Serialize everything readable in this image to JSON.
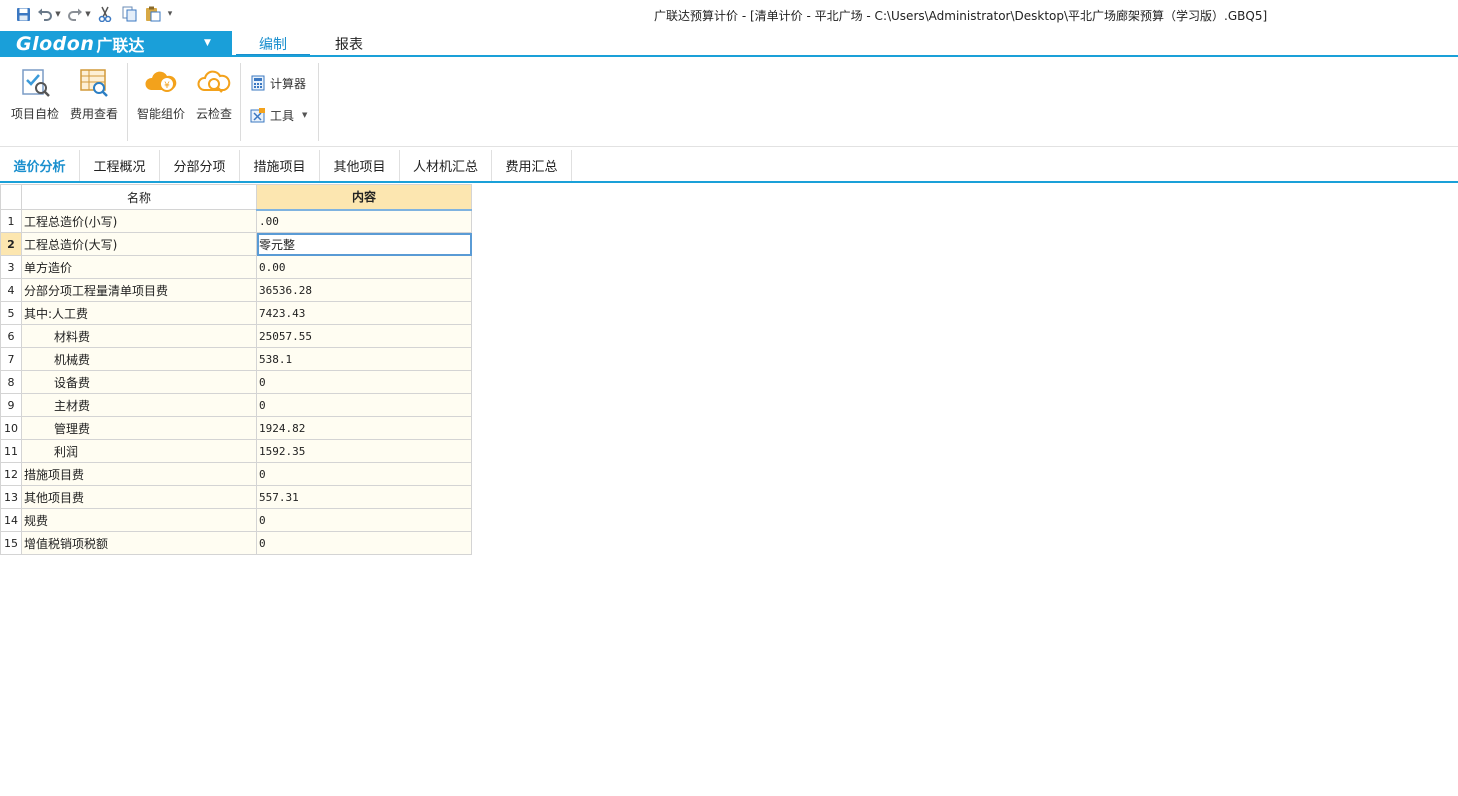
{
  "title": "广联达预算计价 - [清单计价 - 平北广场 - C:\\Users\\Administrator\\Desktop\\平北广场廊架预算（学习版）.GBQ5]",
  "logo": {
    "brand": "Glodon",
    "brand_cn": "广联达"
  },
  "menu": {
    "tabs": [
      {
        "label": "编制"
      },
      {
        "label": "报表"
      }
    ]
  },
  "ribbon": {
    "buttons": [
      {
        "label": "项目自检"
      },
      {
        "label": "费用查看"
      },
      {
        "label": "智能组价"
      },
      {
        "label": "云检查"
      }
    ],
    "small": [
      {
        "label": "计算器"
      },
      {
        "label": "工具"
      }
    ]
  },
  "doc_tabs": [
    {
      "label": "造价分析"
    },
    {
      "label": "工程概况"
    },
    {
      "label": "分部分项"
    },
    {
      "label": "措施项目"
    },
    {
      "label": "其他项目"
    },
    {
      "label": "人材机汇总"
    },
    {
      "label": "费用汇总"
    }
  ],
  "grid": {
    "headers": {
      "name": "名称",
      "content": "内容"
    },
    "rows": [
      {
        "no": "1",
        "name": "工程总造价(小写)",
        "value": ".00"
      },
      {
        "no": "2",
        "name": "工程总造价(大写)",
        "value": "零元整"
      },
      {
        "no": "3",
        "name": "单方造价",
        "value": "0.00"
      },
      {
        "no": "4",
        "name": "分部分项工程量清单项目费",
        "value": "36536.28"
      },
      {
        "no": "5",
        "name": "其中:人工费",
        "value": "7423.43"
      },
      {
        "no": "6",
        "name": "材料费",
        "value": "25057.55"
      },
      {
        "no": "7",
        "name": "机械费",
        "value": "538.1"
      },
      {
        "no": "8",
        "name": "设备费",
        "value": "0"
      },
      {
        "no": "9",
        "name": "主材费",
        "value": "0"
      },
      {
        "no": "10",
        "name": "管理费",
        "value": "1924.82"
      },
      {
        "no": "11",
        "name": "利润",
        "value": "1592.35"
      },
      {
        "no": "12",
        "name": "措施项目费",
        "value": "0"
      },
      {
        "no": "13",
        "name": "其他项目费",
        "value": "557.31"
      },
      {
        "no": "14",
        "name": "规费",
        "value": "0"
      },
      {
        "no": "15",
        "name": "增值税销项税额",
        "value": "0"
      }
    ]
  },
  "colors": {
    "accent": "#1a9fd9",
    "header_highlight": "#fce6b0",
    "cell_bg": "#fffdf2"
  },
  "icons": [
    "save-icon",
    "undo-icon",
    "redo-icon",
    "cut-icon",
    "copy-icon",
    "paste-icon",
    "customize-icon",
    "project-check-icon",
    "fee-view-icon",
    "smart-pricing-icon",
    "cloud-check-icon",
    "calculator-icon",
    "tools-icon"
  ]
}
